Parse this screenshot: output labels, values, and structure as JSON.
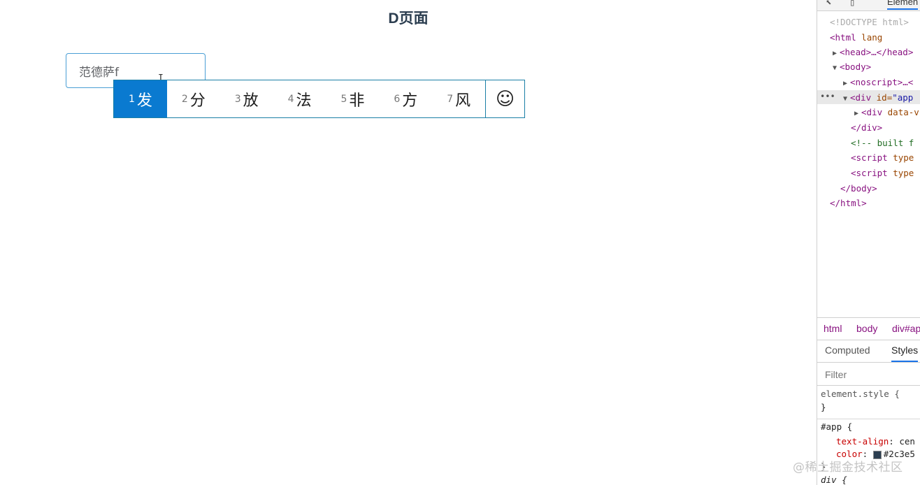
{
  "page": {
    "title": "D页面",
    "input": {
      "value": "范德萨f",
      "placeholder": ""
    }
  },
  "ime": {
    "candidates": [
      {
        "num": "1",
        "text": "发",
        "selected": true
      },
      {
        "num": "2",
        "text": "分"
      },
      {
        "num": "3",
        "text": "放"
      },
      {
        "num": "4",
        "text": "法"
      },
      {
        "num": "5",
        "text": "非"
      },
      {
        "num": "6",
        "text": "方"
      },
      {
        "num": "7",
        "text": "风"
      }
    ],
    "emoji_glyph": "☺"
  },
  "devtools": {
    "toolbar": {
      "inspect_icon": "⬉",
      "device_icon": "▯",
      "tab_elements": "Elemen"
    },
    "dom": {
      "doctype": "<!DOCTYPE html>",
      "html_open": "<html",
      "html_attr": "lang",
      "head": "<head>…</head>",
      "body_open": "<body>",
      "noscript": "<noscript>…<",
      "div_app_tag": "<div",
      "div_app_attr": "id=",
      "div_app_val": "\"app",
      "div_data_tag": "<div",
      "div_data_attr": "data-v",
      "div_close": "</div>",
      "comment": "<!-- built f",
      "script1_tag": "<script",
      "script1_attr": "type",
      "script2_tag": "<script",
      "script2_attr": "type",
      "body_close": "</body>",
      "html_close": "</html>",
      "ellipsis": "•••"
    },
    "breadcrumbs": [
      "html",
      "body",
      "div#ap"
    ],
    "panel_tabs": [
      "Computed",
      "Styles"
    ],
    "filter_placeholder": "Filter",
    "styles": {
      "element_style": "element.style {",
      "element_close": "}",
      "app_selector": "#app {",
      "prop1_name": "text-align",
      "prop1_val": "cen",
      "prop2_name": "color",
      "prop2_val": "#2c3e5",
      "app_close": "}",
      "div_selector": "div {"
    },
    "colors": {
      "app_color": "#2c3e50"
    }
  },
  "watermark": "@稀土掘金技术社区"
}
